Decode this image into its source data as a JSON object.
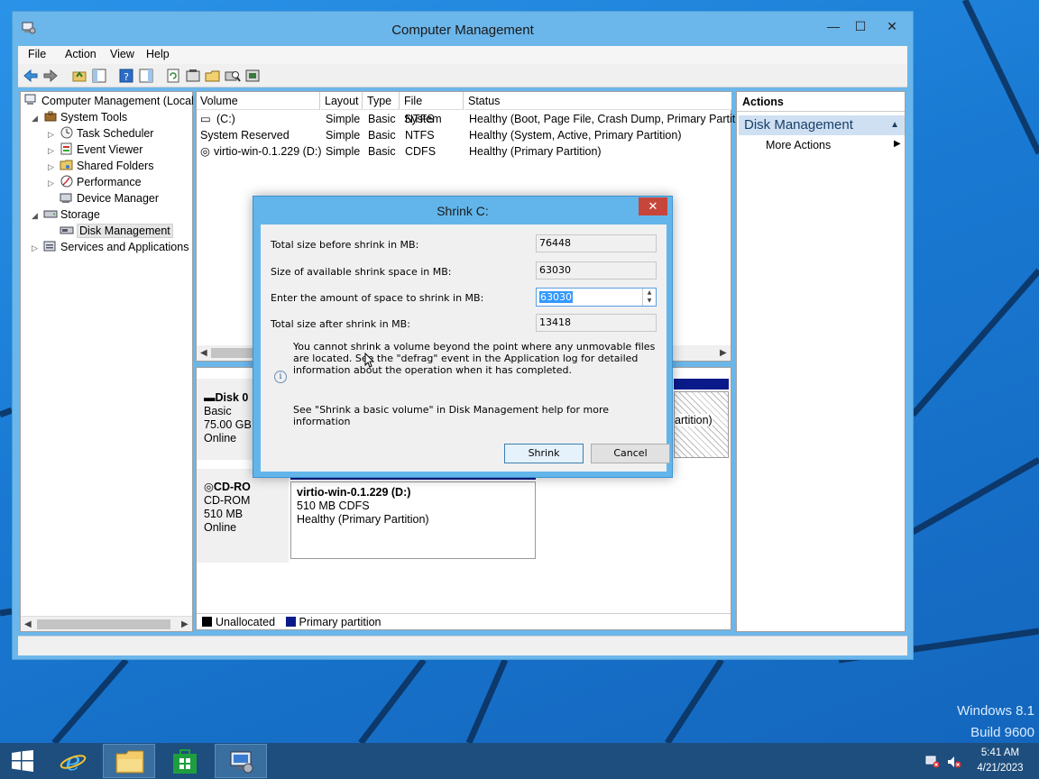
{
  "window": {
    "title": "Computer Management",
    "controls": {
      "minimize": "—",
      "maximize": "☐",
      "close": "✕"
    }
  },
  "menu": [
    "File",
    "Action",
    "View",
    "Help"
  ],
  "tree": {
    "root": "Computer Management (Local",
    "system_tools": "System Tools",
    "task_scheduler": "Task Scheduler",
    "event_viewer": "Event Viewer",
    "shared_folders": "Shared Folders",
    "performance": "Performance",
    "device_manager": "Device Manager",
    "storage": "Storage",
    "disk_management": "Disk Management",
    "services": "Services and Applications"
  },
  "volumes": {
    "columns": [
      "Volume",
      "Layout",
      "Type",
      "File System",
      "Status"
    ],
    "rows": [
      {
        "volume": "(C:)",
        "layout": "Simple",
        "type": "Basic",
        "fs": "NTFS",
        "status": "Healthy (Boot, Page File, Crash Dump, Primary Partition"
      },
      {
        "volume": "System Reserved",
        "layout": "Simple",
        "type": "Basic",
        "fs": "NTFS",
        "status": "Healthy (System, Active, Primary Partition)"
      },
      {
        "volume": "virtio-win-0.1.229 (D:)",
        "layout": "Simple",
        "type": "Basic",
        "fs": "CDFS",
        "status": "Healthy (Primary Partition)"
      }
    ]
  },
  "diskmap": {
    "disk0": {
      "name": "Disk 0",
      "type": "Basic",
      "size": "75.00 GB",
      "state": "Online",
      "partial_label": "artition)"
    },
    "cdrom": {
      "name": "CD-RO",
      "type": "CD-ROM",
      "size": "510 MB",
      "state": "Online"
    },
    "cd_partition": {
      "name": "virtio-win-0.1.229  (D:)",
      "size": "510 MB CDFS",
      "status": "Healthy (Primary Partition)"
    },
    "legend": {
      "unallocated": "Unallocated",
      "primary": "Primary partition"
    }
  },
  "actions": {
    "header": "Actions",
    "group": "Disk Management",
    "more": "More Actions"
  },
  "dialog": {
    "title": "Shrink C:",
    "close": "✕",
    "total_before_label": "Total size before shrink in MB:",
    "total_before": "76448",
    "available_label": "Size of available shrink space in MB:",
    "available": "63030",
    "amount_label": "Enter the amount of space to shrink in MB:",
    "amount": "63030",
    "after_label": "Total size after shrink in MB:",
    "after": "13418",
    "info": "You cannot shrink a volume beyond the point where any unmovable files are located. See the \"defrag\" event in the Application log for detailed information about the operation when it has completed.",
    "help": "See \"Shrink a basic volume\" in Disk Management help for more information",
    "shrink": "Shrink",
    "cancel": "Cancel"
  },
  "desktop": {
    "edition": "Windows 8.1",
    "build": "Build 9600"
  },
  "taskbar": {
    "time": "5:41 AM",
    "date": "4/21/2023"
  },
  "colors": {
    "accent": "#62b5ea",
    "primary_partition": "#0a1a8a",
    "taskbar": "#1d4e7e"
  }
}
